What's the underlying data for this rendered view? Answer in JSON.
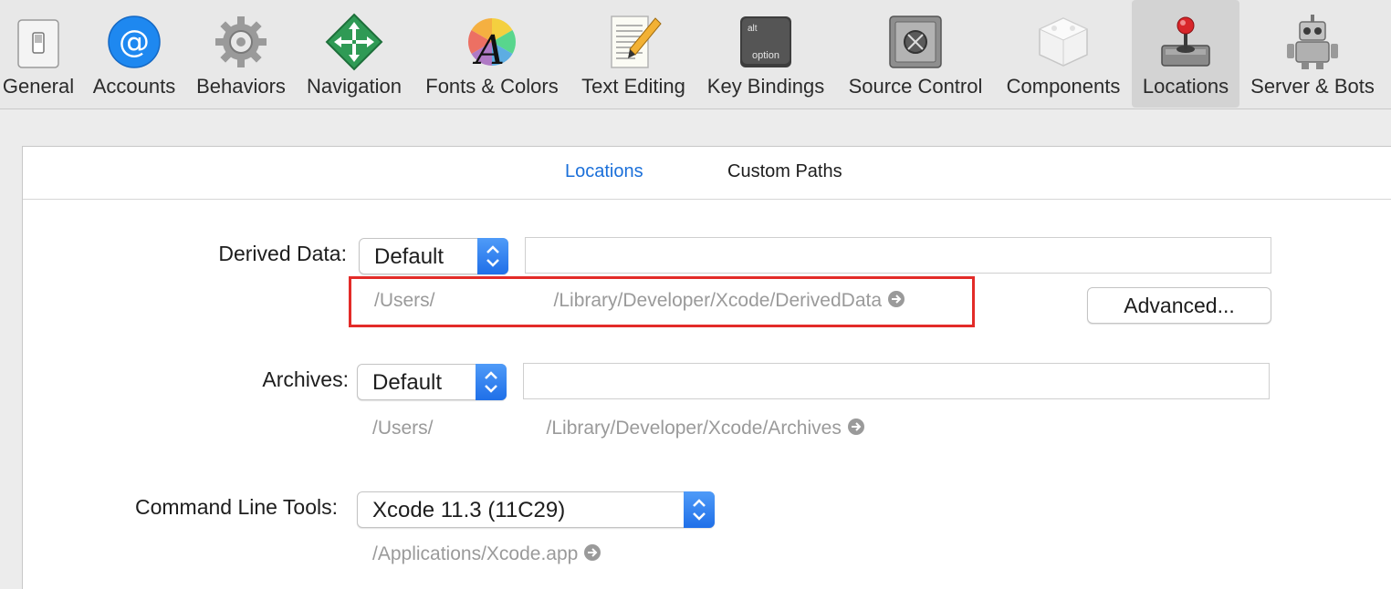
{
  "toolbar": {
    "items": [
      {
        "label": "General",
        "icon": "general-switch-icon"
      },
      {
        "label": "Accounts",
        "icon": "at-sign-icon"
      },
      {
        "label": "Behaviors",
        "icon": "gear-icon"
      },
      {
        "label": "Navigation",
        "icon": "navigation-arrows-icon"
      },
      {
        "label": "Fonts & Colors",
        "icon": "font-color-wheel-icon"
      },
      {
        "label": "Text Editing",
        "icon": "text-pencil-icon"
      },
      {
        "label": "Key Bindings",
        "icon": "option-key-icon"
      },
      {
        "label": "Source Control",
        "icon": "safe-vault-icon"
      },
      {
        "label": "Components",
        "icon": "component-box-icon"
      },
      {
        "label": "Locations",
        "icon": "joystick-drive-icon"
      },
      {
        "label": "Server & Bots",
        "icon": "robot-icon"
      }
    ],
    "selected": "Locations",
    "option_key_top": "alt",
    "option_key_bottom": "option"
  },
  "tabs": {
    "locations": "Locations",
    "custom_paths": "Custom Paths"
  },
  "derived_data": {
    "label": "Derived Data:",
    "popup_value": "Default",
    "path_prefix": "/Users/",
    "path_suffix": "/Library/Developer/Xcode/DerivedData",
    "advanced_button": "Advanced..."
  },
  "archives": {
    "label": "Archives:",
    "popup_value": "Default",
    "path_prefix": "/Users/",
    "path_suffix": "/Library/Developer/Xcode/Archives"
  },
  "command_line_tools": {
    "label": "Command Line Tools:",
    "popup_value": "Xcode 11.3 (11C29)",
    "path": "/Applications/Xcode.app"
  },
  "colors": {
    "accent": "#1a6fd9",
    "highlight": "#e32b28"
  }
}
